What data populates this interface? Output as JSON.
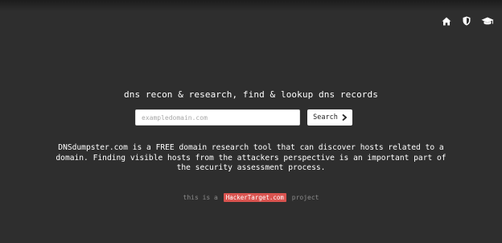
{
  "nav": {
    "icons": [
      "home-icon",
      "shield-icon",
      "graduation-cap-icon"
    ]
  },
  "hero": {
    "tagline": "dns recon & research, find & lookup dns records"
  },
  "search": {
    "placeholder": "exampledomain.com",
    "value": "",
    "button_label": "Search",
    "button_icon": "chevron-right-icon"
  },
  "description": {
    "text": "DNSdumpster.com is a FREE domain research tool that can discover hosts related to a domain. Finding visible hosts from the attackers perspective is an important part of the security assessment process."
  },
  "footer": {
    "prefix": "this is a",
    "badge": "HackerTarget.com",
    "suffix": "project"
  },
  "colors": {
    "background": "#2e2e2e",
    "badge": "#d9534f",
    "muted_text": "#8a8a8a"
  }
}
